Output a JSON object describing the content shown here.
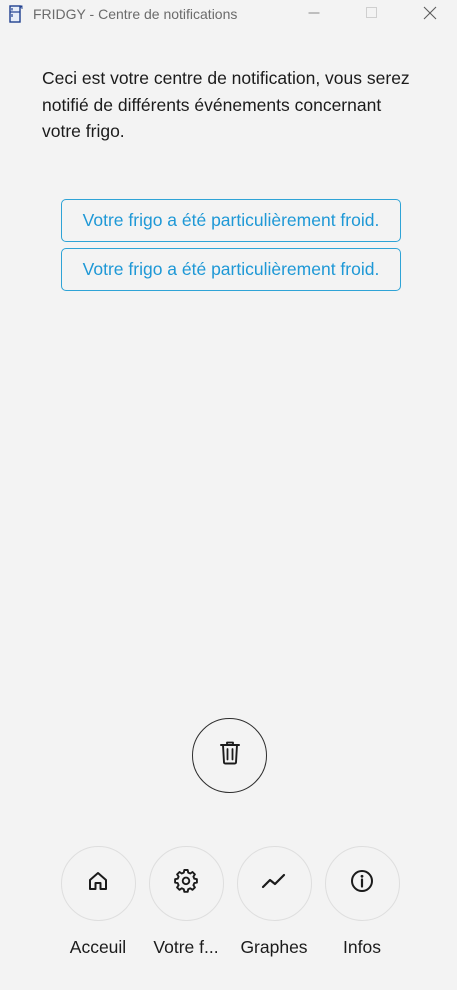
{
  "window": {
    "title": "FRIDGY - Centre de notifications",
    "icon": "fridge-icon",
    "controls": [
      "minimize-icon",
      "maximize-icon",
      "close-icon"
    ]
  },
  "intro": {
    "text": "Ceci est votre centre de notification, vous serez notifié de différents événements concernant votre frigo."
  },
  "notifications": [
    {
      "text": "Votre frigo a été particulièrement froid."
    },
    {
      "text": "Votre frigo a été particulièrement froid."
    }
  ],
  "actions": {
    "delete_icon": "trash-icon"
  },
  "nav": {
    "items": [
      {
        "label": "Acceuil",
        "icon": "home-icon"
      },
      {
        "label": "Votre f...",
        "icon": "gear-icon"
      },
      {
        "label": "Graphes",
        "icon": "chart-line-icon"
      },
      {
        "label": "Infos",
        "icon": "info-icon"
      }
    ]
  },
  "colors": {
    "background": "#f3f3f3",
    "accent": "#1e98d6",
    "text": "#1b1b1b"
  }
}
